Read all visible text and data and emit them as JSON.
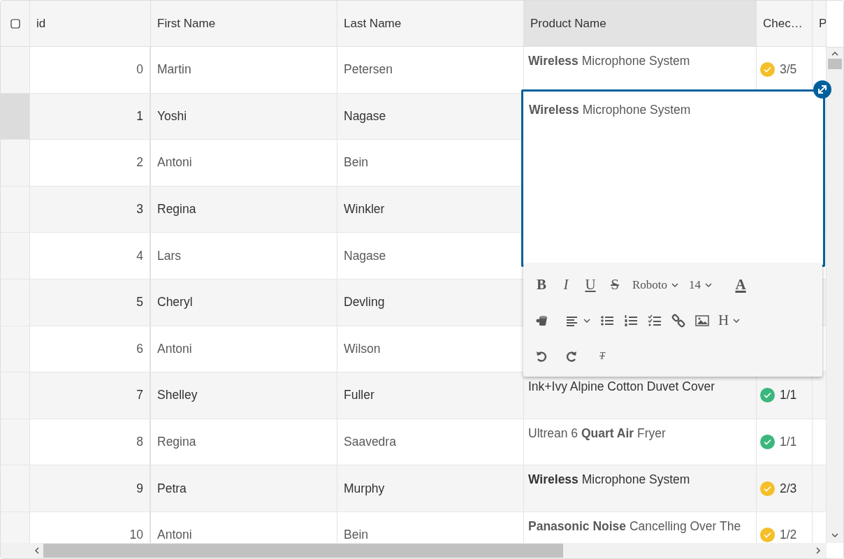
{
  "columns": [
    {
      "label": "id",
      "selected": false
    },
    {
      "label": "First Name",
      "selected": false
    },
    {
      "label": "Last Name",
      "selected": false
    },
    {
      "label": "Product Name",
      "selected": true
    },
    {
      "label": "Chec…",
      "selected": false
    },
    {
      "label": "P",
      "selected": false
    }
  ],
  "header_checkbox": {
    "checked": false
  },
  "rows": [
    {
      "id": "0",
      "first": "Martin",
      "last": "Petersen",
      "selected": false,
      "product": "**Wireless** Microphone System",
      "checklist": {
        "text": "3/5",
        "color": "#f5bf2a"
      }
    },
    {
      "id": "1",
      "first": "Yoshi",
      "last": "Nagase",
      "selected": true
    },
    {
      "id": "2",
      "first": "Antoni",
      "last": "Bein",
      "selected": false
    },
    {
      "id": "3",
      "first": "Regina",
      "last": "Winkler",
      "selected": false
    },
    {
      "id": "4",
      "first": "Lars",
      "last": "Nagase",
      "selected": false
    },
    {
      "id": "5",
      "first": "Cheryl",
      "last": "Devling",
      "selected": false
    },
    {
      "id": "6",
      "first": "Antoni",
      "last": "Wilson",
      "selected": false
    },
    {
      "id": "7",
      "first": "Shelley",
      "last": "Fuller",
      "selected": false,
      "product": "Ink+Ivy Alpine Cotton Duvet Cover",
      "checklist": {
        "text": "1/1",
        "color": "#3bb77e"
      }
    },
    {
      "id": "8",
      "first": "Regina",
      "last": "Saavedra",
      "selected": false,
      "product": "Ultrean 6 **Quart Air** Fryer",
      "checklist": {
        "text": "1/1",
        "color": "#3bb77e"
      }
    },
    {
      "id": "9",
      "first": "Petra",
      "last": "Murphy",
      "selected": false,
      "product": "**Wireless** Microphone System",
      "checklist": {
        "text": "2/3",
        "color": "#f5bf2a"
      }
    },
    {
      "id": "10",
      "first": "Antoni",
      "last": "Bein",
      "selected": false,
      "product": "**Panasonic Noise** Cancelling Over The",
      "checklist": {
        "text": "1/2",
        "color": "#f5bf2a"
      }
    }
  ],
  "editor": {
    "value": "**Wireless** Microphone System",
    "toolbar": {
      "bold": "B",
      "italic": "I",
      "underline": "U",
      "strike": "S",
      "font": "Roboto",
      "size": "14",
      "font_color_label": "A",
      "heading": "H",
      "clear": "T"
    }
  }
}
